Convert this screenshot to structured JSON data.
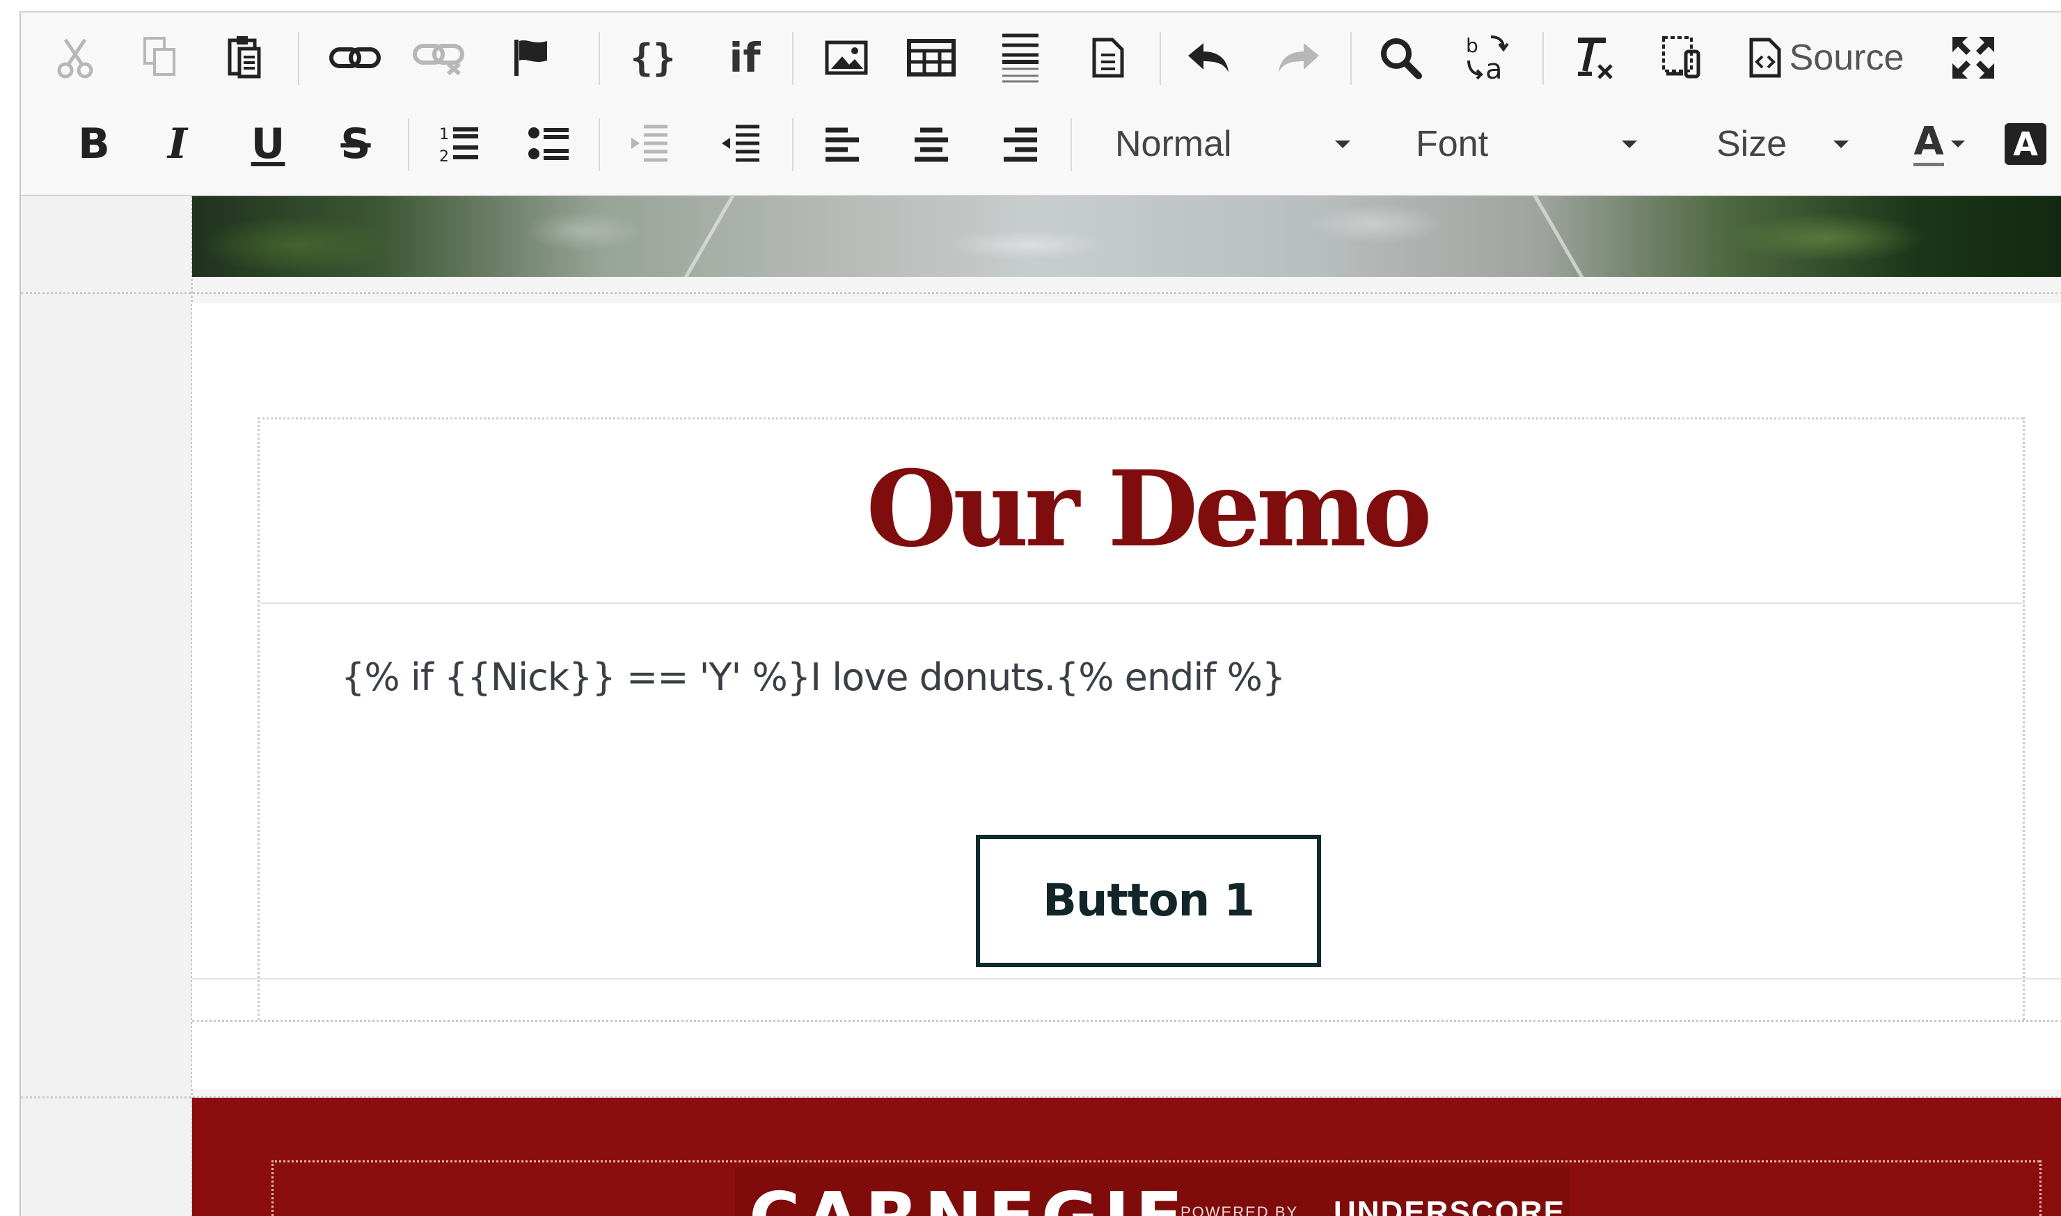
{
  "toolbar": {
    "source_label": "Source",
    "if_label": "if",
    "braces_label": "{}",
    "format_combo": "Normal",
    "font_combo": "Font",
    "size_combo": "Size",
    "bold_label": "B",
    "italic_label": "I",
    "underline_label": "U",
    "strike_label": "S",
    "text_color_label": "A",
    "bg_color_label": "A"
  },
  "content": {
    "headline": "Our Demo",
    "body_text": "{% if {{Nick}} == 'Y' %}I love donuts.{% endif %}",
    "button_label": "Button 1"
  },
  "footer": {
    "logo_text": "CARNEGIE",
    "powered_by": "POWERED BY",
    "underscore": "UNDERSCORE"
  },
  "colors": {
    "brand_red": "#8b0e0e",
    "headline_red": "#800d0d",
    "button_border": "#0e2a2e"
  }
}
